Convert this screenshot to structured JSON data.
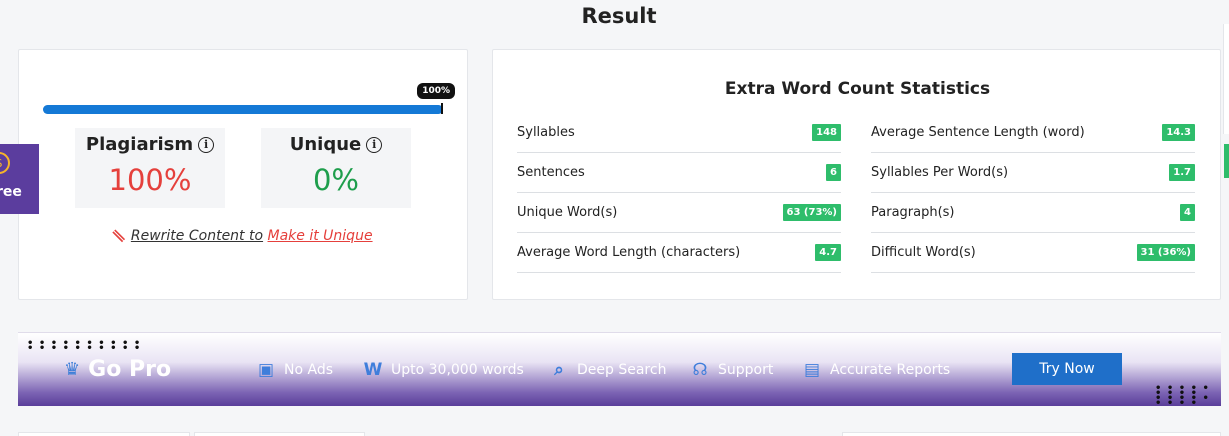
{
  "page": {
    "title": "Result"
  },
  "result": {
    "progress": {
      "percent": 100,
      "label": "100%"
    },
    "plagiarism": {
      "label": "Plagiarism",
      "value": "100%"
    },
    "unique": {
      "label": "Unique",
      "value": "0%"
    },
    "rewrite": {
      "text": "Rewrite Content to",
      "link": "Make it Unique"
    }
  },
  "stats": {
    "title": "Extra Word Count Statistics",
    "left": [
      {
        "label": "Syllables",
        "value": "148"
      },
      {
        "label": "Sentences",
        "value": "6"
      },
      {
        "label": "Unique Word(s)",
        "value": "63 (73%)"
      },
      {
        "label": "Average Word Length (characters)",
        "value": "4.7"
      }
    ],
    "right": [
      {
        "label": "Average Sentence Length (word)",
        "value": "14.3"
      },
      {
        "label": "Syllables Per Word(s)",
        "value": "1.7"
      },
      {
        "label": "Paragraph(s)",
        "value": "4"
      },
      {
        "label": "Difficult Word(s)",
        "value": "31 (36%)"
      }
    ]
  },
  "side_promo": {
    "label": "ree"
  },
  "gopro": {
    "title": "Go Pro",
    "features": [
      {
        "icon": "no-ads-icon",
        "label": "No Ads"
      },
      {
        "icon": "word-icon",
        "label": "Upto 30,000 words"
      },
      {
        "icon": "search-icon",
        "label": "Deep Search"
      },
      {
        "icon": "headset-icon",
        "label": "Support"
      },
      {
        "icon": "report-icon",
        "label": "Accurate Reports"
      }
    ],
    "button": "Try Now"
  },
  "colors": {
    "accent": "#1479d6",
    "danger": "#e5403c",
    "success": "#1e9e4c",
    "badge": "#2ebd6b",
    "promo": "#5b3d9e"
  }
}
